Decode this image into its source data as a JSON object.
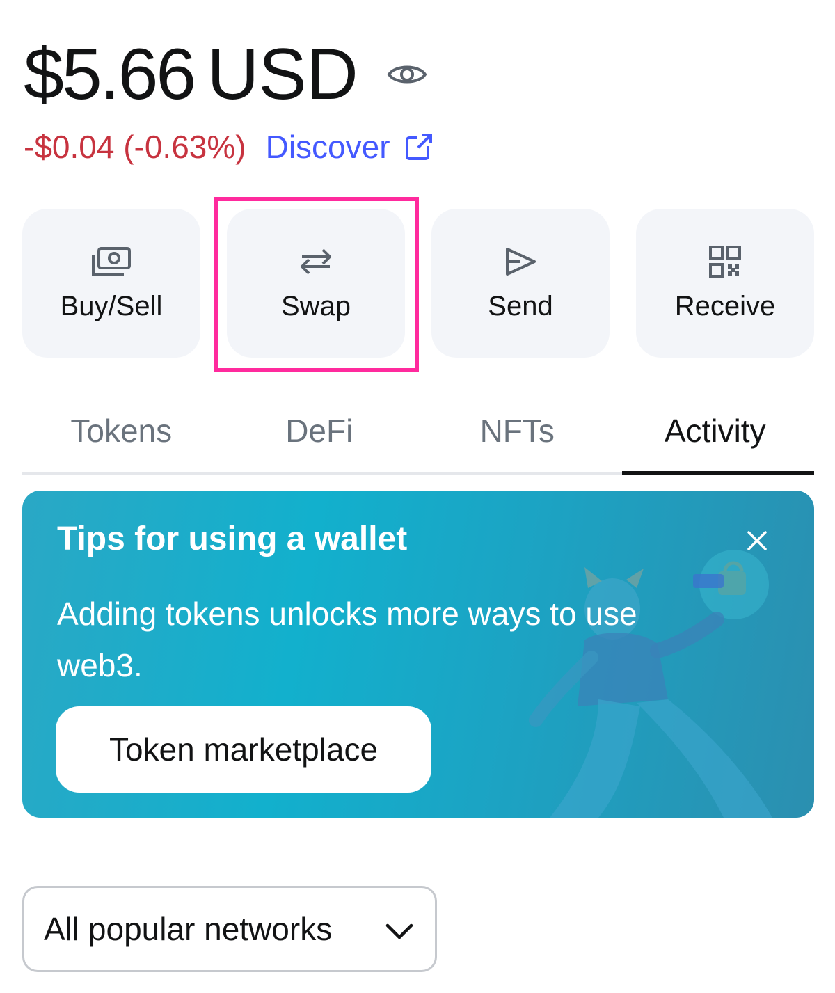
{
  "balance": {
    "amount": "$5.66",
    "currency": "USD",
    "change": "-$0.04 (-0.63%)",
    "discover_label": "Discover"
  },
  "actions": [
    {
      "label": "Buy/Sell",
      "icon": "cash-icon"
    },
    {
      "label": "Swap",
      "icon": "swap-arrows-icon"
    },
    {
      "label": "Send",
      "icon": "send-arrow-icon"
    },
    {
      "label": "Receive",
      "icon": "qr-code-icon"
    }
  ],
  "highlighted_action": "Swap",
  "tabs": [
    {
      "label": "Tokens",
      "active": false
    },
    {
      "label": "DeFi",
      "active": false
    },
    {
      "label": "NFTs",
      "active": false
    },
    {
      "label": "Activity",
      "active": true
    }
  ],
  "tips_banner": {
    "title": "Tips for using a wallet",
    "body": "Adding tokens unlocks more ways to use web3.",
    "cta_label": "Token marketplace"
  },
  "network_filter": {
    "selected": "All popular networks"
  },
  "colors": {
    "negative": "#c7333f",
    "link": "#4459ff",
    "highlight": "#ff2a9d",
    "button_bg": "#f3f5f9",
    "banner": "#12b0cd"
  }
}
